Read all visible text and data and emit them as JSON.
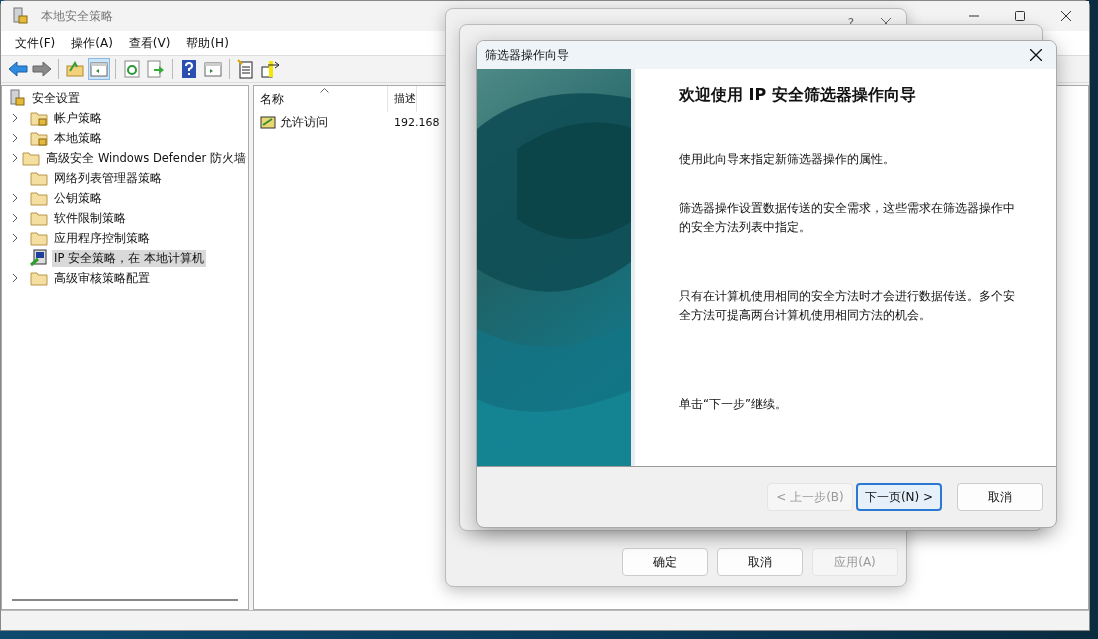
{
  "main_window": {
    "title": "本地安全策略",
    "menu": [
      "文件(F)",
      "操作(A)",
      "查看(V)",
      "帮助(H)"
    ],
    "toolbar": [
      {
        "kind": "back",
        "pressed": false
      },
      {
        "kind": "forward",
        "pressed": false
      },
      {
        "kind": "up",
        "pressed": false
      },
      {
        "kind": "tree",
        "pressed": true
      },
      {
        "kind": "refresh",
        "pressed": false
      },
      {
        "kind": "export",
        "pressed": false
      },
      {
        "kind": "help",
        "pressed": false
      },
      {
        "kind": "panel",
        "pressed": false
      },
      {
        "kind": "new",
        "pressed": false
      },
      {
        "kind": "add",
        "pressed": false
      }
    ],
    "tree": {
      "label": "安全设置",
      "children": [
        {
          "label": "帐户策略",
          "kind": "lock-folder",
          "expandable": true,
          "selected": false
        },
        {
          "label": "本地策略",
          "kind": "lock-folder",
          "expandable": true,
          "selected": false
        },
        {
          "label": "高级安全 Windows Defender 防火墙",
          "kind": "folder",
          "expandable": true,
          "selected": false
        },
        {
          "label": "网络列表管理器策略",
          "kind": "folder",
          "expandable": false,
          "selected": false
        },
        {
          "label": "公钥策略",
          "kind": "folder",
          "expandable": true,
          "selected": false
        },
        {
          "label": "软件限制策略",
          "kind": "folder",
          "expandable": true,
          "selected": false
        },
        {
          "label": "应用程序控制策略",
          "kind": "folder",
          "expandable": true,
          "selected": false
        },
        {
          "label": "IP 安全策略，在 本地计算机",
          "kind": "ip-policy",
          "expandable": false,
          "selected": true
        },
        {
          "label": "高级审核策略配置",
          "kind": "folder",
          "expandable": true,
          "selected": false
        }
      ]
    },
    "list": {
      "columns": [
        "名称",
        "描述"
      ],
      "rows": [
        {
          "name": "允许访问",
          "description": "192.168"
        }
      ]
    }
  },
  "properties_dialog": {
    "help": "?",
    "buttons": [
      {
        "label": "确定",
        "disabled": false
      },
      {
        "label": "取消",
        "disabled": false
      },
      {
        "label": "应用(A)",
        "disabled": true
      }
    ]
  },
  "filter_wizard": {
    "title": "筛选器操作向导",
    "heading": "欢迎使用 IP 安全筛选器操作向导",
    "paragraphs": [
      "使用此向导来指定新筛选器操作的属性。",
      "筛选器操作设置数据传送的安全需求，这些需求在筛选器操作中的安全方法列表中指定。",
      "只有在计算机使用相同的安全方法时才会进行数据传送。多个安全方法可提高两台计算机使用相同方法的机会。",
      "单击“下一步”继续。"
    ],
    "buttons": [
      {
        "label": "< 上一步(B)",
        "disabled": true,
        "default": false
      },
      {
        "label": "下一页(N) >",
        "disabled": false,
        "default": true
      },
      {
        "label": "取消",
        "disabled": false,
        "default": false
      }
    ]
  }
}
